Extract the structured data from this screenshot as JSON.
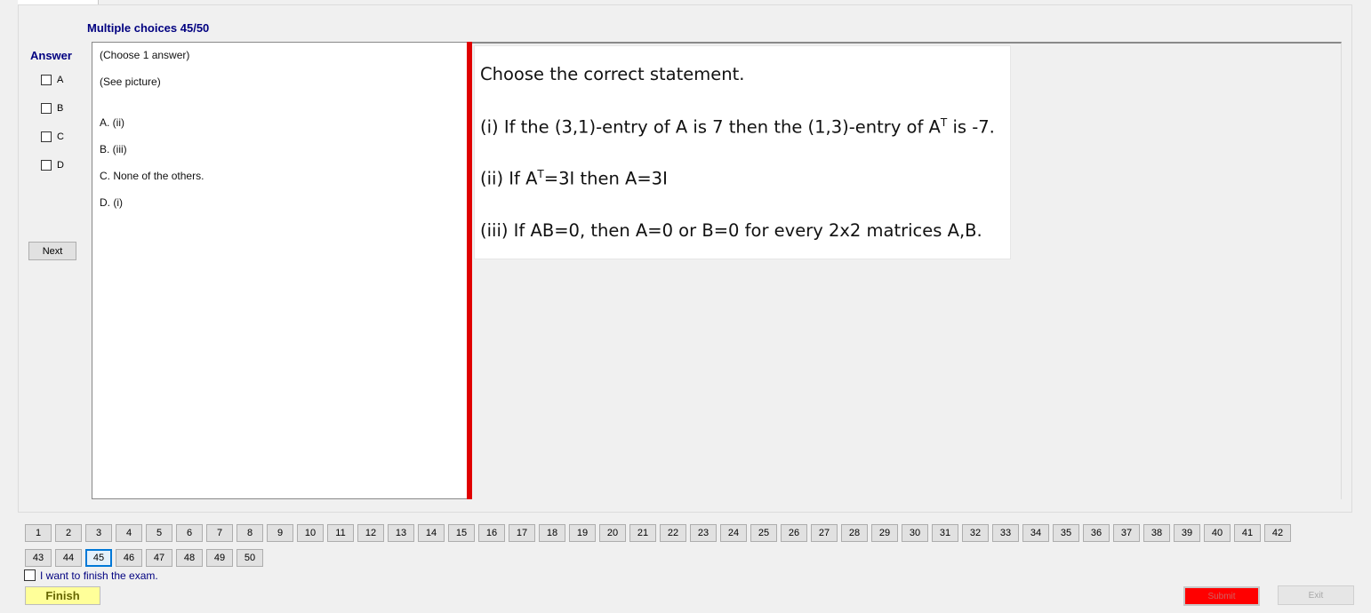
{
  "header": {
    "title": "Multiple choices 45/50"
  },
  "answer_panel": {
    "label": "Answer",
    "options": [
      "A",
      "B",
      "C",
      "D"
    ],
    "next_label": "Next"
  },
  "answer_text": {
    "instruction": "(Choose 1 answer)",
    "see_picture": "(See picture)",
    "choices": [
      "A. (ii)",
      "B. (iii)",
      "C. None of the others.",
      "D. (i)"
    ]
  },
  "question_picture": {
    "prompt": "Choose the correct statement.",
    "s1_a": "(i) If the (3,1)-entry of A is 7 then the (1,3)-entry of A",
    "s1_sup": "T",
    "s1_b": " is -7.",
    "s2_a": "(ii) If A",
    "s2_sup": "T",
    "s2_b": "=3I then A=3I",
    "s3": "(iii) If AB=0, then A=0 or B=0 for every 2x2 matrices A,B."
  },
  "navigation": {
    "current": 45,
    "row1": [
      "1",
      "2",
      "3",
      "4",
      "5",
      "6",
      "7",
      "8",
      "9",
      "10",
      "11",
      "12",
      "13",
      "14",
      "15",
      "16",
      "17",
      "18",
      "19",
      "20",
      "21",
      "22",
      "23",
      "24",
      "25",
      "26",
      "27",
      "28",
      "29",
      "30",
      "31",
      "32",
      "33",
      "34",
      "35",
      "36",
      "37",
      "38",
      "39",
      "40",
      "41",
      "42"
    ],
    "row2": [
      "43",
      "44",
      "45",
      "46",
      "47",
      "48",
      "49",
      "50"
    ]
  },
  "footer": {
    "finish_checkbox_label": "I want to finish the exam.",
    "finish_label": "Finish",
    "submit_label": "Submit",
    "exit_label": "Exit"
  },
  "colors": {
    "title_blue": "#000080",
    "splitter_red": "#e00000",
    "finish_yellow": "#ffff99",
    "submit_red": "#ff0000",
    "current_border": "#0078d7"
  }
}
